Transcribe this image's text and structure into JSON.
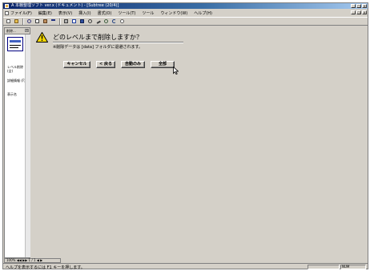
{
  "window": {
    "title": "A 本棚整理ソフト ver.x (ドキュメント) - [Subtree (20/4)]"
  },
  "menubar": {
    "items": [
      "ファイル(F)",
      "編集(E)",
      "表示(V)",
      "挿入(I)",
      "書式(O)",
      "ツール(T)",
      "ツール",
      "ウィンドウ(W)",
      "ヘルプ(H)"
    ]
  },
  "window_controls": {
    "minimize": "_",
    "maximize": "□",
    "close": "×"
  },
  "sidebar": {
    "title": "削除...",
    "close": "×",
    "items": [
      "レベル削除 (全)",
      "詳細情報 (F)",
      "表示名"
    ]
  },
  "dialog": {
    "prompt": "どのレベルまで削除しますか？",
    "notice": "※削除データは [data] フォルダに退避されます。",
    "buttons": [
      "キャンセル",
      "< 戻る",
      "自動のみ",
      "全部"
    ]
  },
  "hscroll": {
    "label": "100% ◀◀ ▶▶ 1 / 1 ◀ ▶"
  },
  "statusbar": {
    "hint": "ヘルプを表示するには F1 キーを押します。",
    "mode": "NUM"
  },
  "colors": {
    "titlebar_start": "#0a246a",
    "titlebar_end": "#a6caf0",
    "face": "#d4d0c8",
    "warning": "#f5d800"
  },
  "icons": [
    "app-icon",
    "new-icon",
    "open-icon",
    "cut-icon",
    "copy-icon",
    "paste-icon",
    "undo-icon",
    "print-icon",
    "preview-icon",
    "find-icon",
    "zoom-icon",
    "help-icon",
    "warning-icon",
    "mouse-cursor-icon"
  ]
}
